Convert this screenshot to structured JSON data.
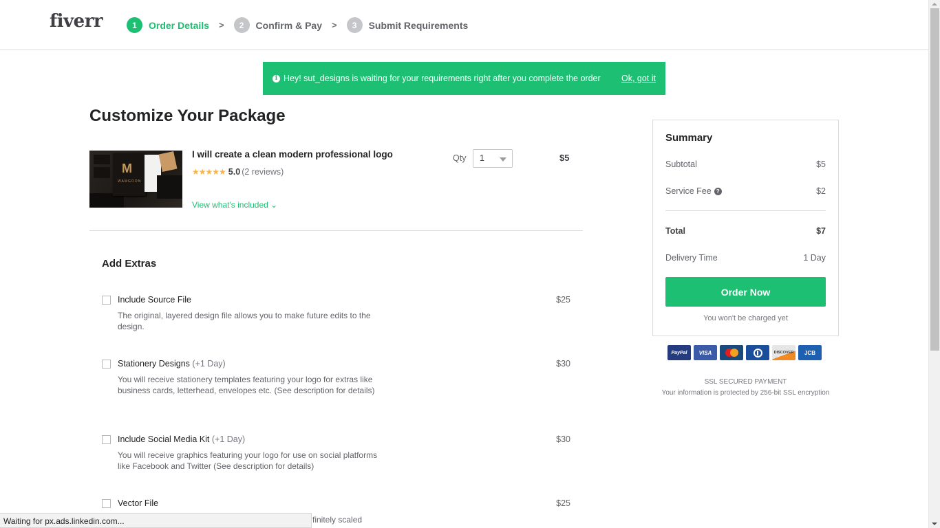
{
  "header": {
    "logo": "fiverr",
    "steps": [
      {
        "number": "1",
        "label": "Order Details",
        "active": true
      },
      {
        "number": "2",
        "label": "Confirm & Pay",
        "active": false
      },
      {
        "number": "3",
        "label": "Submit Requirements",
        "active": false
      }
    ],
    "separator": ">"
  },
  "banner": {
    "icon": "info-icon",
    "message": "Hey! sut_designs is waiting for your requirements right after you complete the order",
    "dismiss_label": "Ok, got it"
  },
  "main": {
    "title": "Customize Your Package",
    "gig": {
      "title": "I will create a clean modern professional logo",
      "stars": "★★★★★",
      "rating": "5.0",
      "reviews": "(2 reviews)",
      "view_included_label": "View what's included ⌄",
      "qty_label": "Qty",
      "qty_value": "1",
      "price": "$5"
    },
    "extras_title": "Add Extras",
    "extras": [
      {
        "name": "Include Source File",
        "days": "",
        "price": "$25",
        "description": "The original, layered design file allows you to make future edits to the design.",
        "checked": false
      },
      {
        "name": "Stationery Designs",
        "days": "(+1 Day)",
        "price": "$30",
        "description": "You will receive stationery templates featuring your logo for extras like business cards, letterhead, envelopes etc. (See description for details)",
        "checked": false
      },
      {
        "name": "Include Social Media Kit",
        "days": "(+1 Day)",
        "price": "$30",
        "description": "You will receive graphics featuring your logo for use on social platforms like Facebook and Twitter (See description for details)",
        "checked": false
      },
      {
        "name": "Vector File",
        "days": "",
        "price": "$25",
        "description_visible": "finitely scaled",
        "checked": false
      }
    ]
  },
  "summary": {
    "title": "Summary",
    "subtotal_label": "Subtotal",
    "subtotal_value": "$5",
    "service_fee_label": "Service Fee",
    "service_fee_value": "$2",
    "total_label": "Total",
    "total_value": "$7",
    "delivery_label": "Delivery Time",
    "delivery_value": "1 Day",
    "order_button": "Order Now",
    "no_charge_note": "You won't be charged yet"
  },
  "payment": {
    "cards": [
      "PayPal",
      "VISA",
      "MasterCard",
      "Diners",
      "DISCOVER",
      "JCB"
    ],
    "ssl_title": "SSL SECURED PAYMENT",
    "ssl_note": "Your information is protected by 256-bit SSL encryption"
  },
  "browser": {
    "status_text": "Waiting for px.ads.linkedin.com..."
  },
  "colors": {
    "brand_green": "#1dbf73",
    "star_gold": "#ffb33e"
  }
}
